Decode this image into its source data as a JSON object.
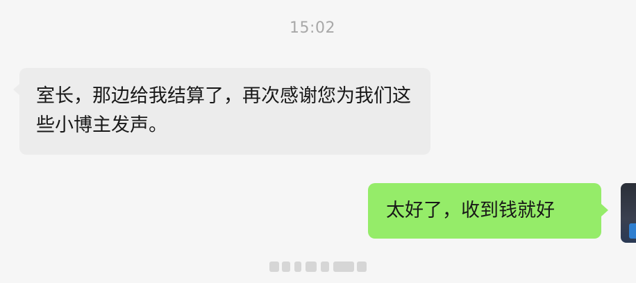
{
  "chat": {
    "timestamp": "15:02",
    "messages": [
      {
        "direction": "received",
        "text": "室长，那边给我结算了，再次感谢您为我们这些小博主发声。"
      },
      {
        "direction": "sent",
        "text": "太好了，收到钱就好"
      }
    ]
  },
  "colors": {
    "background": "#f6f6f6",
    "received_bubble": "#ececec",
    "sent_bubble": "#95ec69",
    "timestamp_text": "#a8a8a8"
  }
}
